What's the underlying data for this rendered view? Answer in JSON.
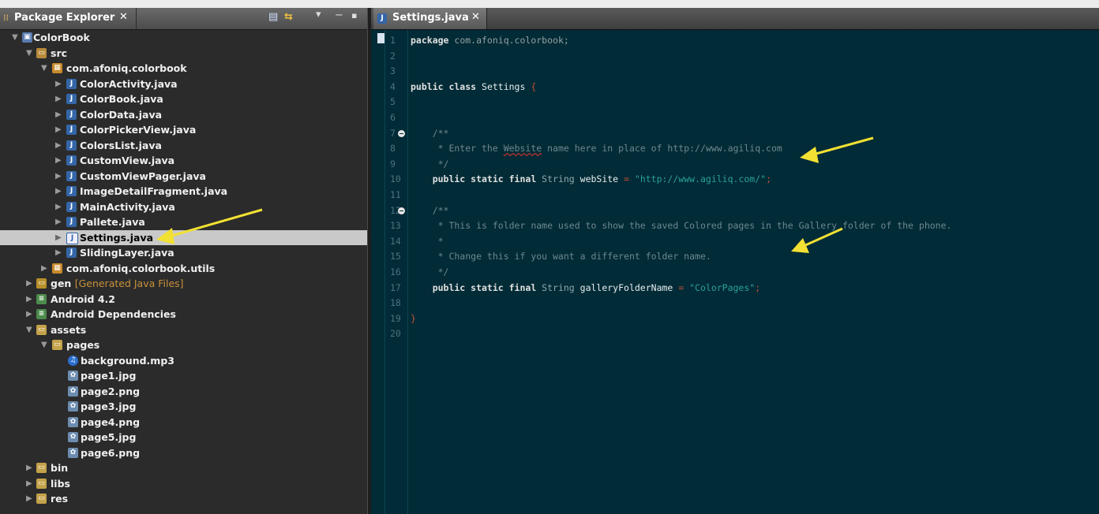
{
  "package_explorer": {
    "title": "Package Explorer",
    "close": "✕",
    "toolbar": {
      "collapse": "▤",
      "link": "⇆",
      "menu": "▾",
      "minimize": "−",
      "maximize": "▪"
    },
    "tree": [
      {
        "label": "ColorBook",
        "icon": "project-icon"
      },
      {
        "label": "src",
        "icon": "source-folder-icon"
      },
      {
        "label": "com.afoniq.colorbook",
        "icon": "package-icon"
      },
      {
        "label": "ColorActivity.java",
        "icon": "java-file-icon"
      },
      {
        "label": "ColorBook.java",
        "icon": "java-file-icon"
      },
      {
        "label": "ColorData.java",
        "icon": "java-file-icon"
      },
      {
        "label": "ColorPickerView.java",
        "icon": "java-file-icon"
      },
      {
        "label": "ColorsList.java",
        "icon": "java-file-icon"
      },
      {
        "label": "CustomView.java",
        "icon": "java-file-icon"
      },
      {
        "label": "CustomViewPager.java",
        "icon": "java-file-icon"
      },
      {
        "label": "ImageDetailFragment.java",
        "icon": "java-file-icon"
      },
      {
        "label": "MainActivity.java",
        "icon": "java-file-icon"
      },
      {
        "label": "Pallete.java",
        "icon": "java-file-icon"
      },
      {
        "label": "Settings.java",
        "icon": "java-file-icon",
        "selected": true
      },
      {
        "label": "SlidingLayer.java",
        "icon": "java-file-icon"
      },
      {
        "label": "com.afoniq.colorbook.utils",
        "icon": "package-icon"
      },
      {
        "label": "gen",
        "decoration": "[Generated Java Files]",
        "icon": "generated-folder-icon"
      },
      {
        "label": "Android 4.2",
        "icon": "library-icon"
      },
      {
        "label": "Android Dependencies",
        "icon": "library-icon"
      },
      {
        "label": "assets",
        "icon": "folder-icon"
      },
      {
        "label": "pages",
        "icon": "open-folder-icon"
      },
      {
        "label": "background.mp3",
        "icon": "audio-file-icon"
      },
      {
        "label": "page1.jpg",
        "icon": "image-file-icon"
      },
      {
        "label": "page2.png",
        "icon": "image-file-icon"
      },
      {
        "label": "page3.jpg",
        "icon": "image-file-icon"
      },
      {
        "label": "page4.png",
        "icon": "image-file-icon"
      },
      {
        "label": "page5.jpg",
        "icon": "image-file-icon"
      },
      {
        "label": "page6.png",
        "icon": "image-file-icon"
      },
      {
        "label": "bin",
        "icon": "folder-icon"
      },
      {
        "label": "libs",
        "icon": "folder-icon"
      },
      {
        "label": "res",
        "icon": "folder-icon"
      }
    ]
  },
  "editor": {
    "tab_title": "Settings.java",
    "tab_close": "✕",
    "line_numbers": [
      "1",
      "2",
      "3",
      "4",
      "5",
      "6",
      "7",
      "8",
      "9",
      "10",
      "11",
      "12",
      "13",
      "14",
      "15",
      "16",
      "17",
      "18",
      "19",
      "20"
    ],
    "code": {
      "l1_kw": "package",
      "l1_rest": " com.afoniq.colorbook;",
      "l4_kw": "public class",
      "l4_name": " Settings ",
      "l4_brace": "{",
      "l7": "    /**",
      "l8_a": "     * Enter the ",
      "l8_b": "Website",
      "l8_c": " name here in place of http://www.agiliq.com",
      "l9": "     */",
      "l10_kw": "    public static final",
      "l10_type": " String",
      "l10_id": " webSite",
      "l10_eq": " = ",
      "l10_str": "\"http://www.agiliq.com/\"",
      "l10_end": ";",
      "l12": "    /**",
      "l13": "     * This is folder name used to show the saved Colored pages in the Gallery folder of the phone.",
      "l14": "     *",
      "l15": "     * Change this if you want a different folder name.",
      "l16": "     */",
      "l17_kw": "    public static final",
      "l17_type": " String",
      "l17_id": " galleryFolderName",
      "l17_eq": " = ",
      "l17_str": "\"ColorPages\"",
      "l17_end": ";",
      "l19": "}"
    }
  },
  "colors": {
    "editor_bg": "#012b36",
    "selection": "#c9c9c9",
    "arrow": "#f2e033",
    "string": "#2aa198",
    "operator": "#c0503a"
  }
}
